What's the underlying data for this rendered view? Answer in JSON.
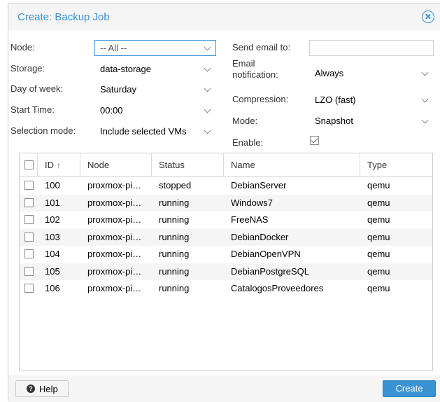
{
  "dialog": {
    "title": "Create: Backup Job"
  },
  "form": {
    "node_label": "Node:",
    "node_value": "-- All --",
    "storage_label": "Storage:",
    "storage_value": "data-storage",
    "day_label": "Day of week:",
    "day_value": "Saturday",
    "start_label": "Start Time:",
    "start_value": "00:00",
    "selection_label": "Selection mode:",
    "selection_value": "Include selected VMs",
    "email_label": "Send email to:",
    "email_value": "",
    "notification_label": "Email notification:",
    "notification_value": "Always",
    "compression_label": "Compression:",
    "compression_value": "LZO (fast)",
    "mode_label": "Mode:",
    "mode_value": "Snapshot",
    "enable_label": "Enable:",
    "enable_checked": true
  },
  "grid": {
    "columns": {
      "id": "ID",
      "node": "Node",
      "status": "Status",
      "name": "Name",
      "type": "Type"
    },
    "sort_indicator": "↑",
    "rows": [
      {
        "id": "100",
        "node": "proxmox-pi…",
        "status": "stopped",
        "name": "DebianServer",
        "type": "qemu"
      },
      {
        "id": "101",
        "node": "proxmox-pi…",
        "status": "running",
        "name": "Windows7",
        "type": "qemu"
      },
      {
        "id": "102",
        "node": "proxmox-pi…",
        "status": "running",
        "name": "FreeNAS",
        "type": "qemu"
      },
      {
        "id": "103",
        "node": "proxmox-pi…",
        "status": "running",
        "name": "DebianDocker",
        "type": "qemu"
      },
      {
        "id": "104",
        "node": "proxmox-pi…",
        "status": "running",
        "name": "DebianOpenVPN",
        "type": "qemu"
      },
      {
        "id": "105",
        "node": "proxmox-pi…",
        "status": "running",
        "name": "DebianPostgreSQL",
        "type": "qemu"
      },
      {
        "id": "106",
        "node": "proxmox-pi…",
        "status": "running",
        "name": "CatalogosProveedores",
        "type": "qemu"
      }
    ]
  },
  "footer": {
    "help_label": "Help",
    "create_label": "Create"
  },
  "icons": {
    "close": "close-circle-icon",
    "help": "question-circle-icon",
    "dropdown": "chevron-down-icon",
    "sort": "arrow-up-icon"
  },
  "colors": {
    "accent": "#3892d4",
    "row_alt": "#f5f5f5"
  }
}
